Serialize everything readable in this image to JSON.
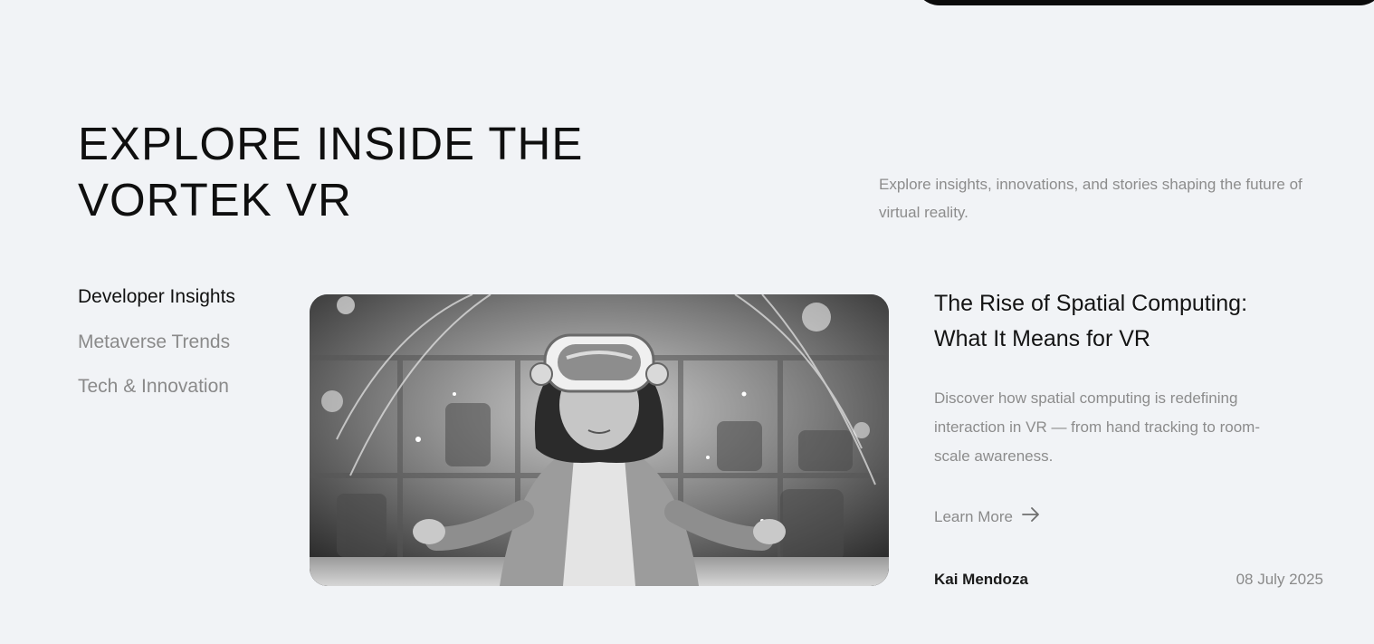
{
  "hero": {
    "title_line1": "EXPLORE INSIDE THE",
    "title_line2": "VORTEK VR",
    "subtitle": "Explore insights, innovations, and stories shaping the future of virtual reality."
  },
  "categories": [
    {
      "label": "Developer Insights",
      "active": true
    },
    {
      "label": "Metaverse Trends",
      "active": false
    },
    {
      "label": "Tech & Innovation",
      "active": false
    }
  ],
  "article": {
    "title_line1": "The Rise of Spatial Computing:",
    "title_line2": "What It Means for VR",
    "description": "Discover how spatial computing is redefining interaction in VR — from hand tracking to room-scale awareness.",
    "cta_label": "Learn More",
    "cta_icon": "arrow-right-icon",
    "author": "Kai Mendoza",
    "date": "08 July 2025"
  },
  "colors": {
    "background": "#f1f3f6",
    "text_primary": "#111111",
    "text_muted": "#8a8a8a",
    "pill": "#0b0b0b"
  }
}
